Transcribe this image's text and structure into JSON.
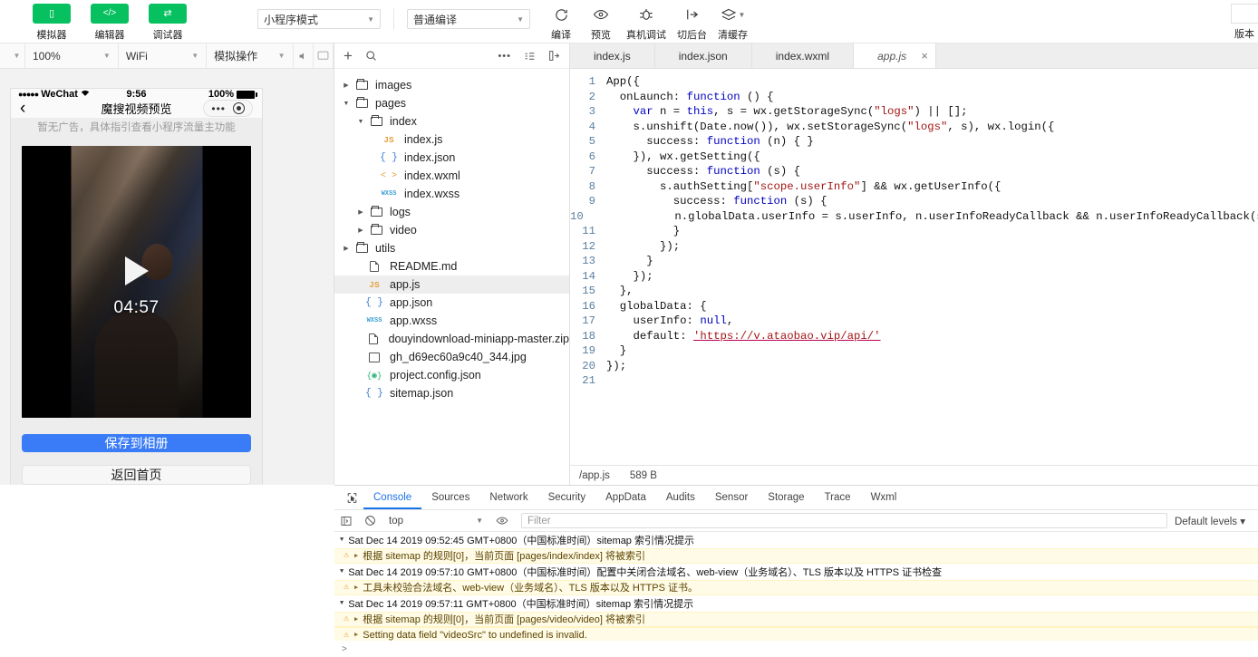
{
  "toolbar": {
    "left_items": [
      {
        "label": "模拟器",
        "icon": "phone-icon",
        "glyph": "▯"
      },
      {
        "label": "编辑器",
        "icon": "code-icon",
        "glyph": "</>"
      },
      {
        "label": "调试器",
        "icon": "debug-icon",
        "glyph": "⇄"
      }
    ],
    "mode_select": "小程序模式",
    "compile_select": "普通编译",
    "actions": [
      {
        "label": "编译",
        "icon": "refresh-icon"
      },
      {
        "label": "预览",
        "icon": "eye-icon"
      },
      {
        "label": "真机调试",
        "icon": "bug-icon"
      },
      {
        "label": "切后台",
        "icon": "background-icon"
      },
      {
        "label": "清缓存",
        "icon": "layers-icon"
      }
    ],
    "far_right_label": "版本",
    "accent_green": "#07c160"
  },
  "simulator": {
    "bar": {
      "device_caret": "chevron-down-icon",
      "zoom": "100%",
      "network": "WiFi",
      "operation": "模拟操作",
      "icons": [
        "volume-icon",
        "message-icon"
      ]
    },
    "status_bar": {
      "carrier": "WeChat",
      "time": "9:56",
      "battery": "100%"
    },
    "nav": {
      "back": "back-icon",
      "title": "魔搜视频预览",
      "capsule_more": "more-dots-icon",
      "capsule_target": "target-icon"
    },
    "ad_note": "暂无广告，具体指引查看小程序流量主功能",
    "video": {
      "duration": "04:57",
      "play": "play-icon"
    },
    "primary_button": "保存到相册",
    "secondary_button": "返回首页"
  },
  "filetree": {
    "toolbar_icons": [
      "add-icon",
      "search-icon",
      "more-icon",
      "sort-icon",
      "collapse-icon"
    ],
    "items": [
      {
        "label": "images",
        "type": "folder",
        "depth": 0,
        "expanded": false
      },
      {
        "label": "pages",
        "type": "folder",
        "depth": 0,
        "expanded": true
      },
      {
        "label": "index",
        "type": "folder",
        "depth": 1,
        "expanded": true
      },
      {
        "label": "index.js",
        "type": "js",
        "depth": 2
      },
      {
        "label": "index.json",
        "type": "json",
        "depth": 2
      },
      {
        "label": "index.wxml",
        "type": "wxml",
        "depth": 2
      },
      {
        "label": "index.wxss",
        "type": "wxss",
        "depth": 2
      },
      {
        "label": "logs",
        "type": "folder",
        "depth": 1,
        "expanded": false
      },
      {
        "label": "video",
        "type": "folder",
        "depth": 1,
        "expanded": false
      },
      {
        "label": "utils",
        "type": "folder",
        "depth": 0,
        "expanded": false
      },
      {
        "label": "README.md",
        "type": "doc",
        "depth": 1
      },
      {
        "label": "app.js",
        "type": "js",
        "depth": 1,
        "selected": true
      },
      {
        "label": "app.json",
        "type": "json",
        "depth": 1
      },
      {
        "label": "app.wxss",
        "type": "wxss",
        "depth": 1
      },
      {
        "label": "douyindownload-miniapp-master.zip",
        "type": "doc",
        "depth": 1
      },
      {
        "label": "gh_d69ec60a9c40_344.jpg",
        "type": "img",
        "depth": 1
      },
      {
        "label": "project.config.json",
        "type": "cfg",
        "depth": 1
      },
      {
        "label": "sitemap.json",
        "type": "json",
        "depth": 1
      }
    ]
  },
  "editor": {
    "tabs": [
      {
        "label": "index.js",
        "active": false
      },
      {
        "label": "index.json",
        "active": false
      },
      {
        "label": "index.wxml",
        "active": false
      },
      {
        "label": "app.js",
        "active": true,
        "close": "×"
      }
    ],
    "lines": [
      {
        "n": "1",
        "segs": [
          {
            "t": "App({"
          }
        ]
      },
      {
        "n": "2",
        "segs": [
          {
            "t": "  onLaunch: "
          },
          {
            "t": "function",
            "c": "k-kw"
          },
          {
            "t": " () {"
          }
        ]
      },
      {
        "n": "3",
        "segs": [
          {
            "t": "    "
          },
          {
            "t": "var",
            "c": "k-kw"
          },
          {
            "t": " n = "
          },
          {
            "t": "this",
            "c": "k-this"
          },
          {
            "t": ", s = wx.getStorageSync("
          },
          {
            "t": "\"logs\"",
            "c": "k-str"
          },
          {
            "t": ") || [];"
          }
        ]
      },
      {
        "n": "4",
        "segs": [
          {
            "t": "    s.unshift(Date.now()), wx.setStorageSync("
          },
          {
            "t": "\"logs\"",
            "c": "k-str"
          },
          {
            "t": ", s), wx.login({"
          }
        ]
      },
      {
        "n": "5",
        "segs": [
          {
            "t": "      success: "
          },
          {
            "t": "function",
            "c": "k-kw"
          },
          {
            "t": " (n) { }"
          }
        ]
      },
      {
        "n": "6",
        "segs": [
          {
            "t": "    }), wx.getSetting({"
          }
        ]
      },
      {
        "n": "7",
        "segs": [
          {
            "t": "      success: "
          },
          {
            "t": "function",
            "c": "k-kw"
          },
          {
            "t": " (s) {"
          }
        ]
      },
      {
        "n": "8",
        "segs": [
          {
            "t": "        s.authSetting["
          },
          {
            "t": "\"scope.userInfo\"",
            "c": "k-str"
          },
          {
            "t": "] && wx.getUserInfo({"
          }
        ]
      },
      {
        "n": "9",
        "segs": [
          {
            "t": "          success: "
          },
          {
            "t": "function",
            "c": "k-kw"
          },
          {
            "t": " (s) {"
          }
        ]
      },
      {
        "n": "10",
        "segs": [
          {
            "t": "            n.globalData.userInfo = s.userInfo, n.userInfoReadyCallback && n.userInfoReadyCallback(s);"
          }
        ]
      },
      {
        "n": "11",
        "segs": [
          {
            "t": "          }"
          }
        ]
      },
      {
        "n": "12",
        "segs": [
          {
            "t": "        });"
          }
        ]
      },
      {
        "n": "13",
        "segs": [
          {
            "t": "      }"
          }
        ]
      },
      {
        "n": "14",
        "segs": [
          {
            "t": "    });"
          }
        ]
      },
      {
        "n": "15",
        "segs": [
          {
            "t": "  },"
          }
        ]
      },
      {
        "n": "16",
        "segs": [
          {
            "t": "  globalData: {"
          }
        ]
      },
      {
        "n": "17",
        "segs": [
          {
            "t": "    userInfo: "
          },
          {
            "t": "null",
            "c": "k-kw"
          },
          {
            "t": ","
          }
        ]
      },
      {
        "n": "18",
        "segs": [
          {
            "t": "    default: "
          },
          {
            "t": "'https://v.ataobao.vip/api/'",
            "c": "k-url"
          }
        ]
      },
      {
        "n": "19",
        "segs": [
          {
            "t": "  }"
          }
        ]
      },
      {
        "n": "20",
        "segs": [
          {
            "t": "});"
          }
        ]
      },
      {
        "n": "21",
        "segs": [
          {
            "t": ""
          }
        ]
      }
    ],
    "status": {
      "path": "/app.js",
      "size": "589 B"
    }
  },
  "devtools": {
    "tabs": [
      "Console",
      "Sources",
      "Network",
      "Security",
      "AppData",
      "Audits",
      "Sensor",
      "Storage",
      "Trace",
      "Wxml"
    ],
    "active_tab": "Console",
    "context": "top",
    "filter_placeholder": "Filter",
    "levels": "Default levels",
    "logs": [
      {
        "kind": "group",
        "text": "Sat Dec 14 2019 09:52:45 GMT+0800（中国标准时间）sitemap 索引情况提示"
      },
      {
        "kind": "warn",
        "text": "根据 sitemap 的规则[0]，当前页面 [pages/index/index] 将被索引"
      },
      {
        "kind": "group",
        "text": "Sat Dec 14 2019 09:57:10 GMT+0800（中国标准时间）配置中关闭合法域名、web-view（业务域名）、TLS 版本以及 HTTPS 证书检查"
      },
      {
        "kind": "warn",
        "text": "工具未校验合法域名、web-view（业务域名）、TLS 版本以及 HTTPS 证书。"
      },
      {
        "kind": "group",
        "text": "Sat Dec 14 2019 09:57:11 GMT+0800（中国标准时间）sitemap 索引情况提示"
      },
      {
        "kind": "warn",
        "text": "根据 sitemap 的规则[0]，当前页面 [pages/video/video] 将被索引"
      },
      {
        "kind": "warn",
        "text": "Setting data field \"videoSrc\" to undefined is invalid."
      }
    ],
    "prompt": ">"
  }
}
